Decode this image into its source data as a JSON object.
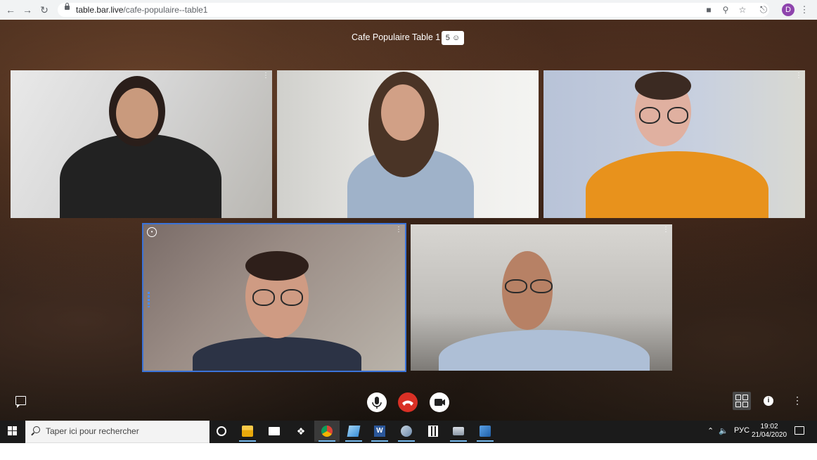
{
  "browser": {
    "url_domain": "table.bar.live",
    "url_path": "/cafe-populaire--table1",
    "profile_initial": "D"
  },
  "meeting": {
    "room_name": "Cafe Populaire Table 1",
    "participant_count": "5",
    "participants": [
      {
        "position": "top-left",
        "active_speaker": false
      },
      {
        "position": "top-center",
        "active_speaker": false
      },
      {
        "position": "top-right",
        "active_speaker": false
      },
      {
        "position": "bottom-left",
        "active_speaker": true
      },
      {
        "position": "bottom-right",
        "active_speaker": false
      }
    ],
    "controls": [
      "microphone",
      "hang-up",
      "camera"
    ],
    "hangup_color": "#d93025",
    "active_tile_color": "#3b73d8"
  },
  "taskbar": {
    "search_placeholder": "Taper ici pour rechercher",
    "language": "РУС",
    "time": "19:02",
    "date": "21/04/2020",
    "apps": [
      "task-view",
      "file-explorer",
      "mail",
      "dropbox",
      "chrome",
      "app-blue",
      "word",
      "app-pen",
      "calculator",
      "app-disk",
      "app-network"
    ]
  }
}
